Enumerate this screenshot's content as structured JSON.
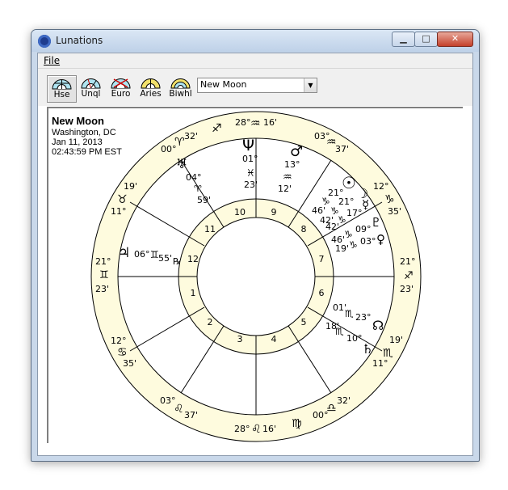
{
  "window": {
    "title": "Lunations",
    "minimize": "▁",
    "maximize": "□",
    "close": "✕"
  },
  "menu": {
    "file": "File"
  },
  "toolbar": {
    "buttons": [
      {
        "label": "Hse",
        "icon": "house-wheel-icon",
        "active": true
      },
      {
        "label": "Unql",
        "icon": "unequal-wheel-icon",
        "active": false
      },
      {
        "label": "Euro",
        "icon": "euro-wheel-icon",
        "active": false
      },
      {
        "label": "Aries",
        "icon": "aries-wheel-icon",
        "active": false
      },
      {
        "label": "Biwhl",
        "icon": "biwheel-icon",
        "active": false
      }
    ],
    "event_select": {
      "value": "New Moon",
      "arrow": "▼"
    }
  },
  "chart_info": {
    "name": "New Moon",
    "location": "Washington, DC",
    "date": "Jan 11, 2013",
    "time": "02:43:59 PM EST"
  },
  "houses": [
    "1",
    "2",
    "3",
    "4",
    "5",
    "6",
    "7",
    "8",
    "9",
    "10",
    "11",
    "12"
  ],
  "cusps": [
    {
      "deg": "28°",
      "sign": "♒",
      "min": "16'"
    },
    {
      "deg": "03°",
      "sign": "♒",
      "min": "37'"
    },
    {
      "deg": "12°",
      "sign": "♑",
      "min": "35'"
    },
    {
      "deg": "21°",
      "sign": "♐",
      "min": "23'"
    },
    {
      "deg": "19'",
      "sign": "♏",
      "min": "11°"
    },
    {
      "deg": "32'",
      "sign": "♎",
      "min": "00°"
    },
    {
      "deg": "28°",
      "sign": "♌",
      "min": "16'"
    },
    {
      "deg": "03°",
      "sign": "♌",
      "min": "37'"
    },
    {
      "deg": "12°",
      "sign": "♋",
      "min": "35'"
    },
    {
      "deg": "21°",
      "sign": "♊",
      "min": "23'"
    },
    {
      "deg": "19'",
      "sign": "♉",
      "min": "11°"
    },
    {
      "deg": "00°",
      "sign": "♈",
      "min": "32'"
    },
    {
      "sign": "♐"
    },
    {
      "sign": "♍"
    }
  ],
  "planets": {
    "neptune": {
      "glyph": "Ψ",
      "deg": "01°",
      "sign": "♓",
      "min": "23'"
    },
    "mars": {
      "glyph": "♂",
      "deg": "13°",
      "sign": "♒",
      "min": "12'"
    },
    "uranus": {
      "glyph": "♅",
      "deg": "04°",
      "sign": "♈",
      "min": "59'"
    },
    "jupiter": {
      "glyph": "♃",
      "deg": "06°",
      "sign": "♊",
      "min": "55'",
      "retro": "℞"
    },
    "sun": {
      "glyph": "☉",
      "deg": "21°",
      "sign": "♑",
      "min": "46'"
    },
    "moon": {
      "glyph": "☽",
      "deg": "21°",
      "sign": "♑",
      "min": "42'"
    },
    "mercury": {
      "glyph": "☿",
      "deg": "17°",
      "sign": "♑",
      "min": "42'"
    },
    "pluto": {
      "glyph": "♇",
      "deg": "09°",
      "sign": "♑",
      "min": "46'"
    },
    "venus": {
      "glyph": "♀",
      "deg": "03°",
      "sign": "♑",
      "min": "19'"
    },
    "node": {
      "glyph": "☊",
      "deg": "23°",
      "sign": "♏",
      "min": "01'"
    },
    "saturn": {
      "glyph": "♄",
      "deg": "10°",
      "sign": "♏",
      "min": "18'"
    }
  }
}
